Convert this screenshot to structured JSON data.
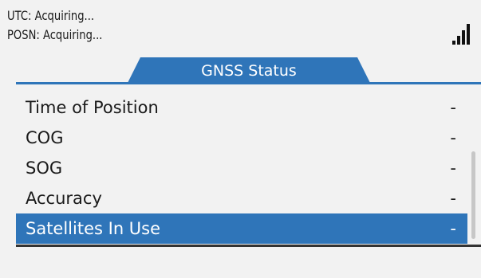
{
  "status": {
    "utc_line": "UTC:   Acquiring...",
    "posn_line": "POSN: Acquiring...",
    "signal_icon": "signal-strength-icon"
  },
  "tab": {
    "title": "GNSS Status",
    "color": "#2f75b9"
  },
  "rows": [
    {
      "label": "Time of Position",
      "value": "-"
    },
    {
      "label": "COG",
      "value": "-"
    },
    {
      "label": "SOG",
      "value": "-"
    },
    {
      "label": "Accuracy",
      "value": "-"
    },
    {
      "label": "Satellites In Use",
      "value": "-",
      "selected": true
    }
  ]
}
